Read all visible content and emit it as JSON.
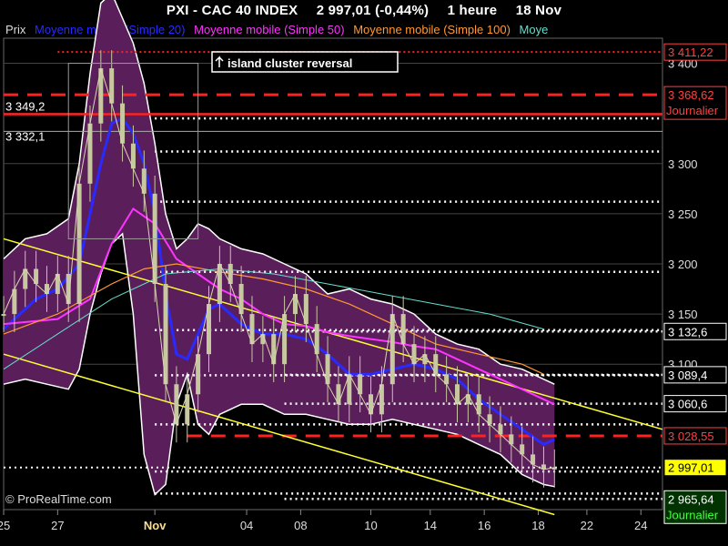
{
  "header": {
    "instrument": "PXI - CAC 40 INDEX",
    "quote": "2 997,01 (-0,44%)",
    "timeframe": "1 heure",
    "date": "18 Nov"
  },
  "legend": {
    "items": [
      {
        "label": "Prix",
        "color": "#dddddd"
      },
      {
        "label": "Moyenne mobile (Simple 20)",
        "color": "#2a2aff"
      },
      {
        "label": "Moyenne mobile (Simple 50)",
        "color": "#ff33ff"
      },
      {
        "label": "Moyenne mobile (Simple 100)",
        "color": "#ff9933"
      },
      {
        "label": "Moye",
        "color": "#66ddcc"
      }
    ]
  },
  "annotation": "island cluster reversal",
  "watermark": "© ProRealTime.com",
  "colors": {
    "background": "#000000",
    "grid": "#444444",
    "bollinger_fill": "#5a1f5a",
    "bollinger_edge": "#ffffff",
    "ma20": "#2a2aff",
    "ma50": "#ff33ff",
    "ma100": "#ff9933",
    "ma200": "#66ddcc",
    "resistance": "#ff2020",
    "channel": "#ffff33",
    "candle": "#c8c8a0"
  },
  "chart_data": {
    "type": "line",
    "ylim": [
      2955,
      3425
    ],
    "y_ticks": [
      3100,
      3150,
      3200,
      3250,
      3300,
      3350,
      3400
    ],
    "y_tick_labels": [
      "3 100",
      "3 150",
      "3 200",
      "3 250",
      "3 300",
      "3 350",
      "3 400"
    ],
    "x_categories": [
      "25",
      "27",
      "Nov",
      "04",
      "08",
      "10",
      "14",
      "16",
      "18",
      "22",
      "24"
    ],
    "series": [
      {
        "name": "Prix",
        "x": [
          0,
          2,
          4,
          6,
          8,
          10,
          12,
          14,
          16,
          18,
          20,
          22,
          24,
          26,
          28,
          30,
          32,
          34,
          36,
          38,
          40,
          42,
          44,
          46,
          48,
          50,
          52,
          54,
          56,
          58,
          60,
          62,
          64,
          66,
          68,
          70,
          72,
          74,
          76,
          78,
          80,
          82,
          84,
          86,
          88,
          90,
          92,
          94,
          96,
          98,
          100,
          102
        ],
        "values": [
          3150,
          3175,
          3195,
          3180,
          3170,
          3190,
          3160,
          3280,
          3340,
          3395,
          3360,
          3320,
          3295,
          3270,
          3180,
          3080,
          3040,
          3070,
          3110,
          3160,
          3200,
          3180,
          3150,
          3120,
          3130,
          3100,
          3150,
          3170,
          3140,
          3110,
          3080,
          3060,
          3090,
          3070,
          3050,
          3080,
          3150,
          3120,
          3100,
          3110,
          3090,
          3080,
          3060,
          3070,
          3050,
          3040,
          3030,
          3020,
          3010,
          3000,
          2995,
          2997
        ]
      },
      {
        "name": "Moyenne mobile (Simple 20)",
        "x": [
          0,
          6,
          10,
          14,
          18,
          20,
          22,
          24,
          26,
          28,
          30,
          32,
          34,
          36,
          38,
          40,
          44,
          48,
          52,
          56,
          60,
          64,
          68,
          72,
          76,
          80,
          84,
          88,
          92,
          96,
          100,
          102
        ],
        "values": [
          3135,
          3165,
          3175,
          3200,
          3300,
          3340,
          3345,
          3330,
          3300,
          3250,
          3170,
          3110,
          3105,
          3130,
          3155,
          3160,
          3140,
          3130,
          3130,
          3125,
          3110,
          3090,
          3090,
          3095,
          3100,
          3095,
          3085,
          3065,
          3050,
          3035,
          3020,
          3025
        ]
      },
      {
        "name": "Moyenne mobile (Simple 50)",
        "x": [
          0,
          10,
          16,
          20,
          24,
          28,
          32,
          36,
          40,
          44,
          48,
          52,
          56,
          60,
          64,
          68,
          72,
          76,
          80,
          84,
          88,
          92,
          96,
          100,
          102
        ],
        "values": [
          3140,
          3145,
          3165,
          3220,
          3255,
          3240,
          3205,
          3190,
          3175,
          3165,
          3150,
          3140,
          3138,
          3132,
          3128,
          3125,
          3122,
          3118,
          3115,
          3105,
          3095,
          3085,
          3075,
          3065,
          3060
        ]
      },
      {
        "name": "Moyenne mobile (Simple 100)",
        "x": [
          0,
          10,
          20,
          26,
          32,
          40,
          48,
          56,
          64,
          72,
          80,
          88,
          96,
          100
        ],
        "values": [
          3130,
          3150,
          3180,
          3195,
          3200,
          3192,
          3185,
          3175,
          3160,
          3140,
          3120,
          3110,
          3100,
          3090
        ]
      },
      {
        "name": "Moye",
        "x": [
          0,
          10,
          20,
          30,
          40,
          50,
          60,
          70,
          80,
          90,
          100
        ],
        "values": [
          3095,
          3130,
          3165,
          3190,
          3195,
          3190,
          3180,
          3170,
          3160,
          3150,
          3135
        ]
      }
    ],
    "bollinger": {
      "x": [
        0,
        4,
        8,
        12,
        14,
        16,
        18,
        20,
        22,
        24,
        26,
        28,
        30,
        32,
        34,
        36,
        38,
        40,
        44,
        48,
        52,
        56,
        60,
        64,
        68,
        72,
        76,
        80,
        84,
        88,
        92,
        96,
        100,
        102
      ],
      "upper": [
        3205,
        3225,
        3230,
        3245,
        3300,
        3390,
        3460,
        3470,
        3445,
        3420,
        3380,
        3320,
        3250,
        3215,
        3225,
        3240,
        3235,
        3225,
        3215,
        3210,
        3200,
        3190,
        3170,
        3175,
        3165,
        3160,
        3150,
        3130,
        3120,
        3115,
        3100,
        3095,
        3085,
        3080
      ],
      "lower": [
        3080,
        3085,
        3080,
        3075,
        3095,
        3150,
        3190,
        3220,
        3230,
        3150,
        3010,
        2970,
        2980,
        3060,
        3090,
        3040,
        3030,
        3050,
        3060,
        3060,
        3050,
        3050,
        3045,
        3040,
        3040,
        3045,
        3040,
        3035,
        3030,
        3020,
        3010,
        2990,
        2980,
        2978
      ]
    },
    "levels": [
      {
        "value": 3411.22,
        "label": "3 411,22",
        "style": "dotted-red"
      },
      {
        "value": 3368.62,
        "label": "3 368,62",
        "sub": "Journalier",
        "style": "dashed-red"
      },
      {
        "value": 3349.2,
        "label": "3 349,2",
        "style": "solid-red"
      },
      {
        "value": 3332.1,
        "label": "3 332,1",
        "style": "white-thin"
      },
      {
        "value": 3132.6,
        "label": "3 132,6",
        "style": "dotted-white"
      },
      {
        "value": 3089.4,
        "label": "3 089,4",
        "style": "dotted-white"
      },
      {
        "value": 3060.6,
        "label": "3 060,6",
        "style": "dotted-white"
      },
      {
        "value": 3028.55,
        "label": "3 028,55",
        "style": "dashed-red"
      },
      {
        "value": 2997.01,
        "label": "2 997,01",
        "style": "price"
      },
      {
        "value": 2965.64,
        "label": "2 965,64",
        "sub": "Journalier",
        "style": "dotted-white"
      }
    ],
    "extra_dotted_levels": [
      3345,
      3312,
      3262,
      3192,
      3134,
      3089,
      3040,
      2993,
      2971
    ],
    "channel_lines": [
      {
        "x": [
          0,
          122
        ],
        "values": [
          3225,
          3035
        ]
      },
      {
        "x": [
          0,
          102
        ],
        "values": [
          3110,
          2950
        ]
      }
    ]
  }
}
